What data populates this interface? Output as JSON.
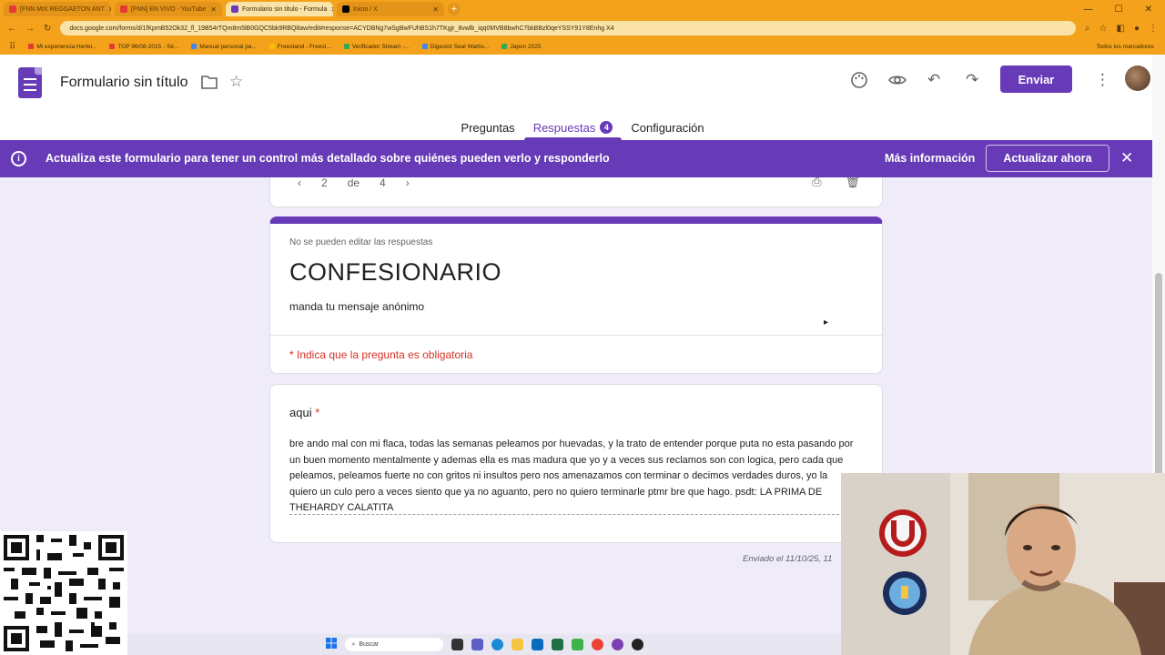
{
  "browser": {
    "tabs": [
      {
        "label": "[FNN MIX REGGAETON ANT",
        "color": "#e53935",
        "active": false
      },
      {
        "label": "[FNN] EN VIVO - YouTube",
        "color": "#e53935",
        "active": false
      },
      {
        "label": "Formulario sin título - Formula",
        "color": "#673ab7",
        "active": true
      },
      {
        "label": "Inicio / X",
        "color": "#000000",
        "active": false
      }
    ],
    "new_tab": "+",
    "url": "docs.google.com/forms/d/1fKpmB52Ok32_fl_19B54rTQm8m5lB0GQC5bk9RBQ8aw/edit#response=ACYDBNg7wSgBwFUhBS1h7TKgjr_8vwlb_iqq0MVB8bwhC7bkBBzl0qeYSSY91Y8Enhg X4",
    "bookmarks": [
      {
        "label": "Mi experiencia Herlei...",
        "color": "#e53935"
      },
      {
        "label": "TOP 96/08-2015 - Sé...",
        "color": "#e53935"
      },
      {
        "label": "Manual personal pa...",
        "color": "#4285f4"
      },
      {
        "label": "Freestand - Freest...",
        "color": "#fbbc05"
      },
      {
        "label": "Verificador Stream -...",
        "color": "#34a853"
      },
      {
        "label": "Digestor Seal Warbs...",
        "color": "#4285f4"
      },
      {
        "label": "Japon 2025",
        "color": "#34a853"
      }
    ],
    "all_bookmarks": "Todos los marcadores"
  },
  "header": {
    "title": "Formulario sin título",
    "send_label": "Enviar",
    "tabs": [
      {
        "label": "Preguntas",
        "active": false
      },
      {
        "label": "Respuestas",
        "active": true,
        "badge": "4"
      },
      {
        "label": "Configuración",
        "active": false
      }
    ]
  },
  "banner": {
    "text": "Actualiza este formulario para tener un control más detallado sobre quiénes pueden verlo y responderlo",
    "more_info": "Más información",
    "update_now": "Actualizar ahora"
  },
  "response_nav": {
    "current": "2",
    "separator": "de",
    "total": "4"
  },
  "form": {
    "readonly_note": "No se pueden editar las respuestas",
    "title": "CONFESIONARIO",
    "description": "manda tu mensaje anónimo",
    "required_note": "* Indica que la pregunta es obligatoria"
  },
  "question": {
    "label": "aqui",
    "required_mark": "*",
    "answer": "bre ando mal con mi flaca, todas las semanas peleamos por huevadas, y la trato de entender porque puta no esta pasando por un buen momento mentalmente y ademas ella es mas madura que yo y a veces sus reclamos son con logica, pero cada que peleamos, peleamos fuerte no con gritos ni insultos pero nos amenazamos con terminar o decimos verdades duros, yo la quiero un culo pero a veces siento que ya no aguanto, pero no quiero terminarle ptmr bre que hago. psdt: LA PRIMA DE THEHARDY CALATITA"
  },
  "sent_at": "Enviado el 11/10/25, 11",
  "taskbar": {
    "search_placeholder": "Buscar"
  },
  "colors": {
    "accent": "#673ab7",
    "required": "#d93025",
    "browser_theme": "#f4a21c",
    "background": "#f0ebf8"
  }
}
